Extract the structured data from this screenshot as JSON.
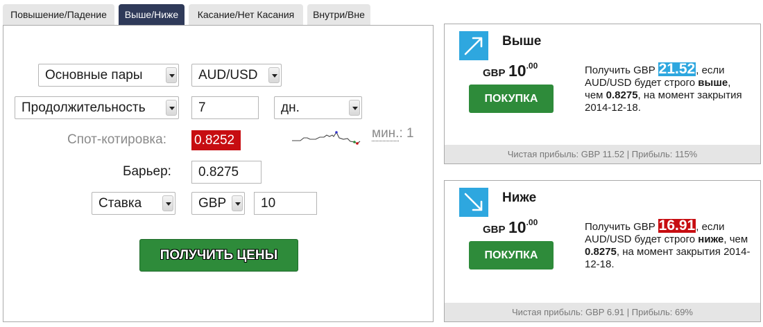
{
  "tabs": [
    {
      "label": "Повышение/Падение",
      "active": false
    },
    {
      "label": "Выше/Ниже",
      "active": true
    },
    {
      "label": "Касание/Нет Касания",
      "active": false
    },
    {
      "label": "Внутри/Вне",
      "active": false
    }
  ],
  "form": {
    "market_select": "Основные пары",
    "underlying_select": "AUD/USD",
    "duration_select": "Продолжительность",
    "duration_value": "7",
    "duration_unit": "дн.",
    "duration_min_label": "мин.",
    "duration_min_value": ": 1",
    "spot_label": "Спот-котировка:",
    "spot_value": "0.8252",
    "barrier_label": "Барьер:",
    "barrier_value": "0.8275",
    "amount_type_select": "Ставка",
    "currency_select": "GBP",
    "amount_value": "10",
    "get_prices_label": "ПОЛУЧИТЬ ЦЕНЫ"
  },
  "contracts": [
    {
      "title": "Выше",
      "icon": "arrow-up-right-icon",
      "stake_currency": "GBP",
      "stake_amount": "10",
      "stake_decimals": ".00",
      "buy_label": "ПОКУПКА",
      "desc_pre": "Получить GBP",
      "payout": "21.52",
      "desc_mid1": ", если AUD/USD будет строго",
      "direction": "выше",
      "desc_mid2": ", чем",
      "barrier": "0.8275",
      "desc_post": ", на момент закрытия 2014-12-18.",
      "footer": "Чистая прибыль: GBP 11.52 | Прибыль: 115%",
      "payout_color": "#2ea7df"
    },
    {
      "title": "Ниже",
      "icon": "arrow-down-right-icon",
      "stake_currency": "GBP",
      "stake_amount": "10",
      "stake_decimals": ".00",
      "buy_label": "ПОКУПКА",
      "desc_pre": "Получить GBP",
      "payout": "16.91",
      "desc_mid1": ", если AUD/USD будет строго",
      "direction": "ниже",
      "desc_mid2": ", чем",
      "barrier": "0.8275",
      "desc_post": ", на момент закрытия 2014-12-18.",
      "footer": "Чистая прибыль: GBP 6.91 | Прибыль: 69%",
      "payout_color": "#c70d11"
    }
  ],
  "colors": {
    "active_tab": "#2f3a59",
    "buy_button": "#2e8b3a",
    "spot_badge": "#c70d11",
    "icon_box": "#2ea7df"
  }
}
